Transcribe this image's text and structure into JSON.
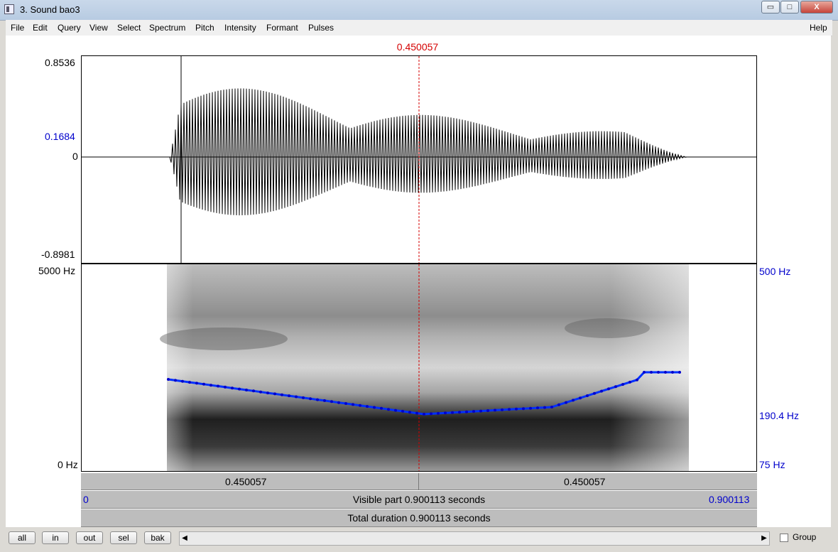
{
  "window": {
    "title": "3. Sound bao3",
    "buttons": {
      "minimize": "▭",
      "maximize": "□",
      "close": "X"
    }
  },
  "menu": {
    "items": [
      "File",
      "Edit",
      "Query",
      "View",
      "Select",
      "Spectrum",
      "Pitch",
      "Intensity",
      "Formant",
      "Pulses"
    ],
    "help": "Help"
  },
  "cursor": {
    "time_label": "0.450057"
  },
  "waveform": {
    "y_max": "0.8536",
    "y_cursor": "0.1684",
    "y_zero": "0",
    "y_min": "-0.8981"
  },
  "spectrogram": {
    "freq_max": "5000 Hz",
    "freq_min": "0 Hz",
    "pitch_max": "500 Hz",
    "pitch_cursor": "190.4 Hz",
    "pitch_min": "75 Hz"
  },
  "time_bars": {
    "left_segment": "0.450057",
    "right_segment": "0.450057",
    "visible_start": "0",
    "visible_end": "0.900113",
    "visible_text": "Visible part 0.900113 seconds",
    "total_text": "Total duration 0.900113 seconds"
  },
  "bottom": {
    "buttons": [
      "all",
      "in",
      "out",
      "sel",
      "bak"
    ],
    "scroll_left": "◀",
    "scroll_right": "▶",
    "group_label": "Group"
  },
  "colors": {
    "cursor": "#d40000",
    "pitch": "#0000ff",
    "axis_labels": "#0000cc"
  }
}
